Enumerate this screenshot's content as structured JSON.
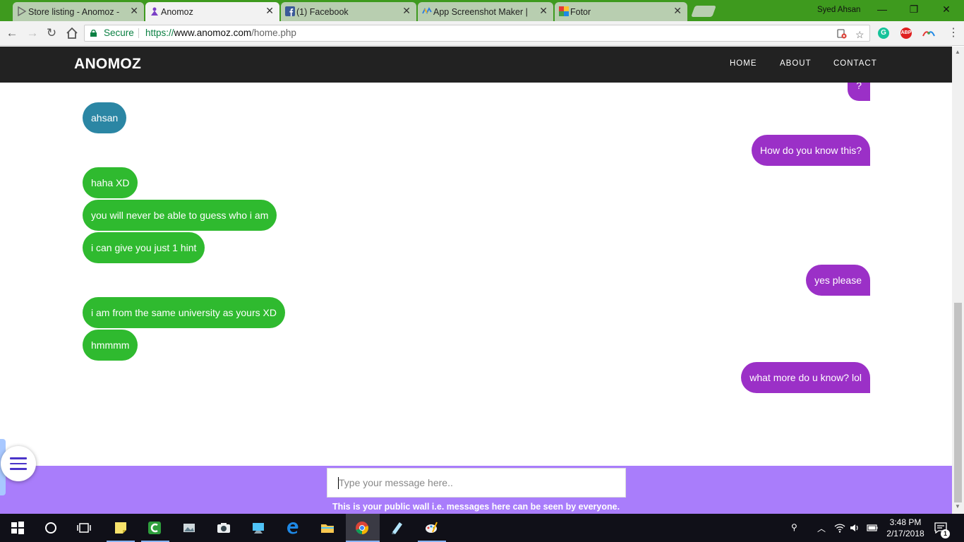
{
  "browser": {
    "tabs": [
      {
        "title": "Store listing - Anomoz -",
        "icon": "play-store-icon",
        "active": false
      },
      {
        "title": "Anomoz",
        "icon": "anomoz-logo-icon",
        "active": true
      },
      {
        "title": "(1) Facebook",
        "icon": "facebook-icon",
        "active": false
      },
      {
        "title": "App Screenshot Maker |",
        "icon": "screenshot-maker-icon",
        "active": false
      },
      {
        "title": "Fotor",
        "icon": "fotor-icon",
        "active": false
      }
    ],
    "profile_name": "Syed Ahsan",
    "secure_label": "Secure",
    "url_protocol": "https://",
    "url_host": "www.anomoz.com",
    "url_path": "/home.php",
    "extensions": [
      "grammarly-icon",
      "adblock-plus-icon",
      "extension-icon"
    ],
    "extension_abp_text": "ABP"
  },
  "site": {
    "brand": "ANOMOZ",
    "nav": [
      "HOME",
      "ABOUT",
      "CONTACT"
    ]
  },
  "chat": {
    "messages": [
      {
        "side": "right",
        "text": "?",
        "color": "#9b30c7"
      },
      {
        "side": "left",
        "text": "ahsan",
        "color": "#2b86a4"
      },
      {
        "side": "right",
        "text": "How do you know this?",
        "color": "#9b30c7"
      },
      {
        "side": "left",
        "text": "haha XD",
        "color": "#2fba2f"
      },
      {
        "side": "left",
        "text": "you will never be able to guess who i am",
        "color": "#2fba2f"
      },
      {
        "side": "left",
        "text": "i can give you just 1 hint",
        "color": "#2fba2f"
      },
      {
        "side": "right",
        "text": "yes please",
        "color": "#9b30c7"
      },
      {
        "side": "left",
        "text": "i am from the same university as yours XD",
        "color": "#2fba2f"
      },
      {
        "side": "left",
        "text": "hmmmm",
        "color": "#2fba2f"
      },
      {
        "side": "right",
        "text": "what more do u know? lol",
        "color": "#9b30c7"
      }
    ]
  },
  "composer": {
    "placeholder": "Type your message here..",
    "note": "This is your public wall i.e. messages here can be seen by everyone.",
    "background": "#a97dfb"
  },
  "taskbar": {
    "time": "3:48 PM",
    "date": "2/17/2018",
    "notification_count": "1",
    "apps": [
      "start-icon",
      "cortana-icon",
      "task-view-icon",
      "sticky-notes-icon",
      "camtasia-icon",
      "photos-icon",
      "camera-icon",
      "screen-tool-icon",
      "edge-icon",
      "file-explorer-icon",
      "chrome-icon",
      "notepad-icon",
      "paint-icon"
    ]
  }
}
